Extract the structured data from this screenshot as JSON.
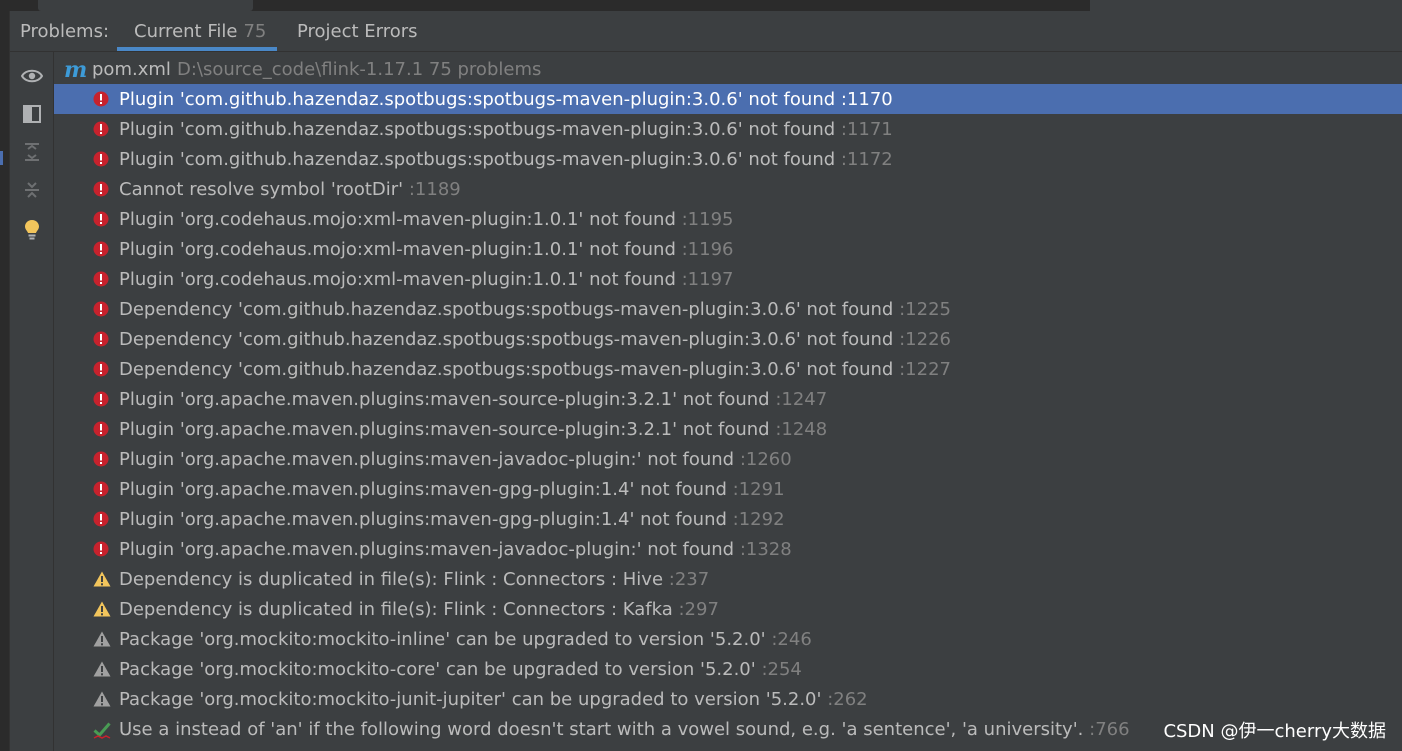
{
  "header": {
    "title": "Problems:",
    "tabs": [
      {
        "label": "Current File",
        "count": "75"
      },
      {
        "label": "Project Errors",
        "count": ""
      }
    ]
  },
  "file": {
    "name": "pom.xml",
    "path": "D:\\source_code\\flink-1.17.1  75 problems"
  },
  "problems": [
    {
      "severity": "error",
      "message": "Plugin 'com.github.hazendaz.spotbugs:spotbugs-maven-plugin:3.0.6' not found",
      "line": ":1170",
      "selected": true
    },
    {
      "severity": "error",
      "message": "Plugin 'com.github.hazendaz.spotbugs:spotbugs-maven-plugin:3.0.6' not found",
      "line": ":1171"
    },
    {
      "severity": "error",
      "message": "Plugin 'com.github.hazendaz.spotbugs:spotbugs-maven-plugin:3.0.6' not found",
      "line": ":1172"
    },
    {
      "severity": "error",
      "message": "Cannot resolve symbol 'rootDir'",
      "line": ":1189"
    },
    {
      "severity": "error",
      "message": "Plugin 'org.codehaus.mojo:xml-maven-plugin:1.0.1' not found",
      "line": ":1195"
    },
    {
      "severity": "error",
      "message": "Plugin 'org.codehaus.mojo:xml-maven-plugin:1.0.1' not found",
      "line": ":1196"
    },
    {
      "severity": "error",
      "message": "Plugin 'org.codehaus.mojo:xml-maven-plugin:1.0.1' not found",
      "line": ":1197"
    },
    {
      "severity": "error",
      "message": "Dependency 'com.github.hazendaz.spotbugs:spotbugs-maven-plugin:3.0.6' not found",
      "line": ":1225"
    },
    {
      "severity": "error",
      "message": "Dependency 'com.github.hazendaz.spotbugs:spotbugs-maven-plugin:3.0.6' not found",
      "line": ":1226"
    },
    {
      "severity": "error",
      "message": "Dependency 'com.github.hazendaz.spotbugs:spotbugs-maven-plugin:3.0.6' not found",
      "line": ":1227"
    },
    {
      "severity": "error",
      "message": "Plugin 'org.apache.maven.plugins:maven-source-plugin:3.2.1' not found",
      "line": ":1247"
    },
    {
      "severity": "error",
      "message": "Plugin 'org.apache.maven.plugins:maven-source-plugin:3.2.1' not found",
      "line": ":1248"
    },
    {
      "severity": "error",
      "message": "Plugin 'org.apache.maven.plugins:maven-javadoc-plugin:' not found",
      "line": ":1260"
    },
    {
      "severity": "error",
      "message": "Plugin 'org.apache.maven.plugins:maven-gpg-plugin:1.4' not found",
      "line": ":1291"
    },
    {
      "severity": "error",
      "message": "Plugin 'org.apache.maven.plugins:maven-gpg-plugin:1.4' not found",
      "line": ":1292"
    },
    {
      "severity": "error",
      "message": "Plugin 'org.apache.maven.plugins:maven-javadoc-plugin:' not found",
      "line": ":1328"
    },
    {
      "severity": "warning",
      "message": "Dependency is duplicated in file(s): Flink : Connectors : Hive ",
      "line": ":237"
    },
    {
      "severity": "warning",
      "message": "Dependency is duplicated in file(s): Flink : Connectors : Kafka ",
      "line": ":297"
    },
    {
      "severity": "weak-warning",
      "message": "Package 'org.mockito:mockito-inline' can be upgraded to version '5.2.0'",
      "line": ":246"
    },
    {
      "severity": "weak-warning",
      "message": "Package 'org.mockito:mockito-core' can be upgraded to version '5.2.0'",
      "line": ":254"
    },
    {
      "severity": "weak-warning",
      "message": "Package 'org.mockito:mockito-junit-jupiter' can be upgraded to version '5.2.0'",
      "line": ":262"
    },
    {
      "severity": "typo",
      "message": "Use a instead of 'an' if the following word doesn't start with a vowel sound, e.g. 'a sentence', 'a university'.",
      "line": ":766"
    }
  ],
  "toolbar": {
    "icons": [
      "eye-icon",
      "preview-pane-icon",
      "expand-all-icon",
      "collapse-all-icon",
      "lightbulb-icon"
    ]
  },
  "watermark": "CSDN @伊一cherry大数据",
  "colors": {
    "background": "#3c3f41",
    "selection": "#4b6eaf",
    "error": "#c7222d",
    "warning": "#f2c55c",
    "weak_warning": "#a0a0a0",
    "typo_check": "#499c54"
  }
}
